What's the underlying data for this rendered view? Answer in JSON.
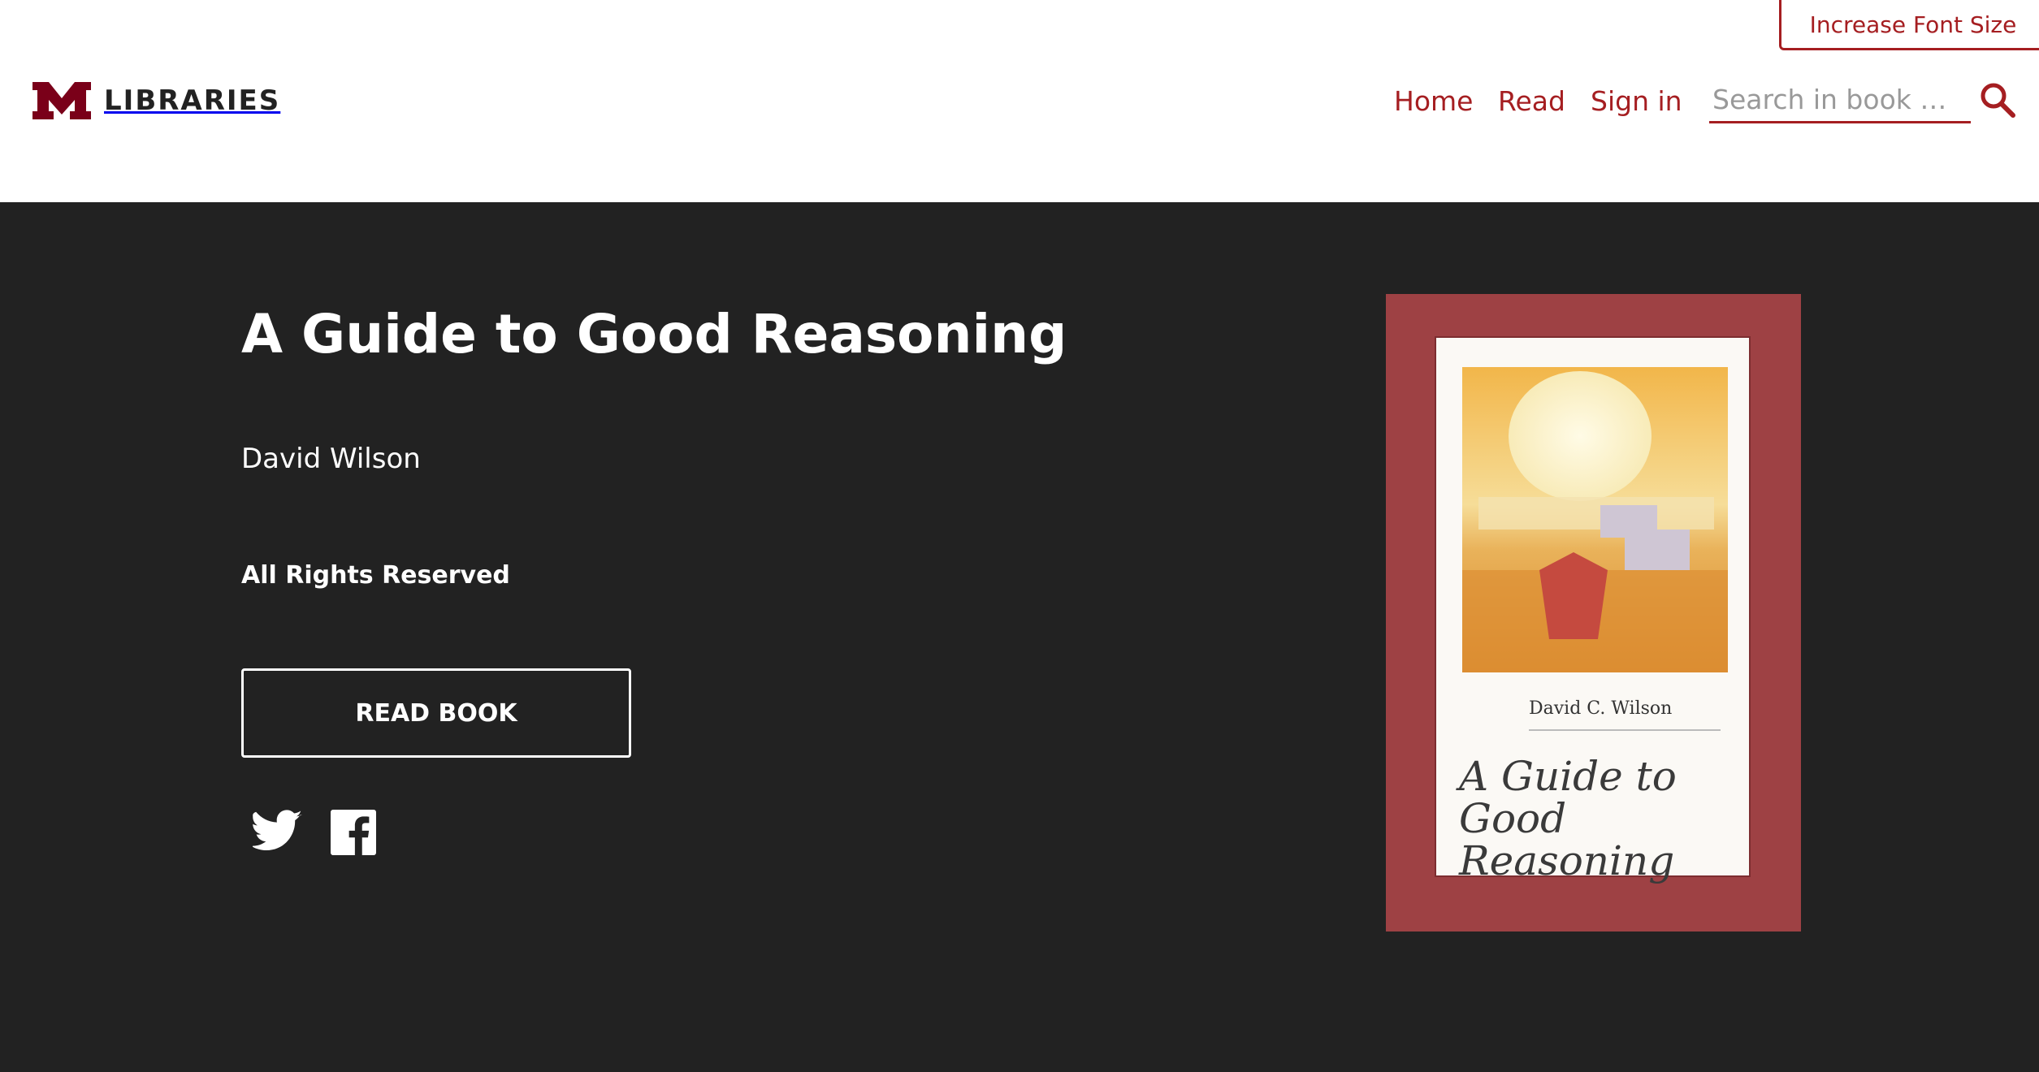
{
  "header": {
    "font_size_button": "Increase Font Size",
    "logo_text": "LIBRARIES",
    "nav": [
      {
        "label": "Home"
      },
      {
        "label": "Read"
      },
      {
        "label": "Sign in"
      }
    ],
    "search": {
      "placeholder": "Search in book …",
      "value": ""
    },
    "icons": {
      "logo": "university-m-logo",
      "search": "search-icon"
    }
  },
  "book": {
    "title": "A Guide to Good Reasoning",
    "author": "David Wilson",
    "license": "All Rights Reserved",
    "read_button": "READ BOOK",
    "share_icons": [
      "twitter-icon",
      "facebook-icon"
    ],
    "cover": {
      "author": "David C. Wilson",
      "title_line1": "A Guide to",
      "title_line2": "Good Reasoning"
    }
  },
  "colors": {
    "accent": "#a51e21",
    "hero_background": "#222222",
    "cover_background": "#9e4144",
    "text_on_dark": "#ffffff"
  }
}
